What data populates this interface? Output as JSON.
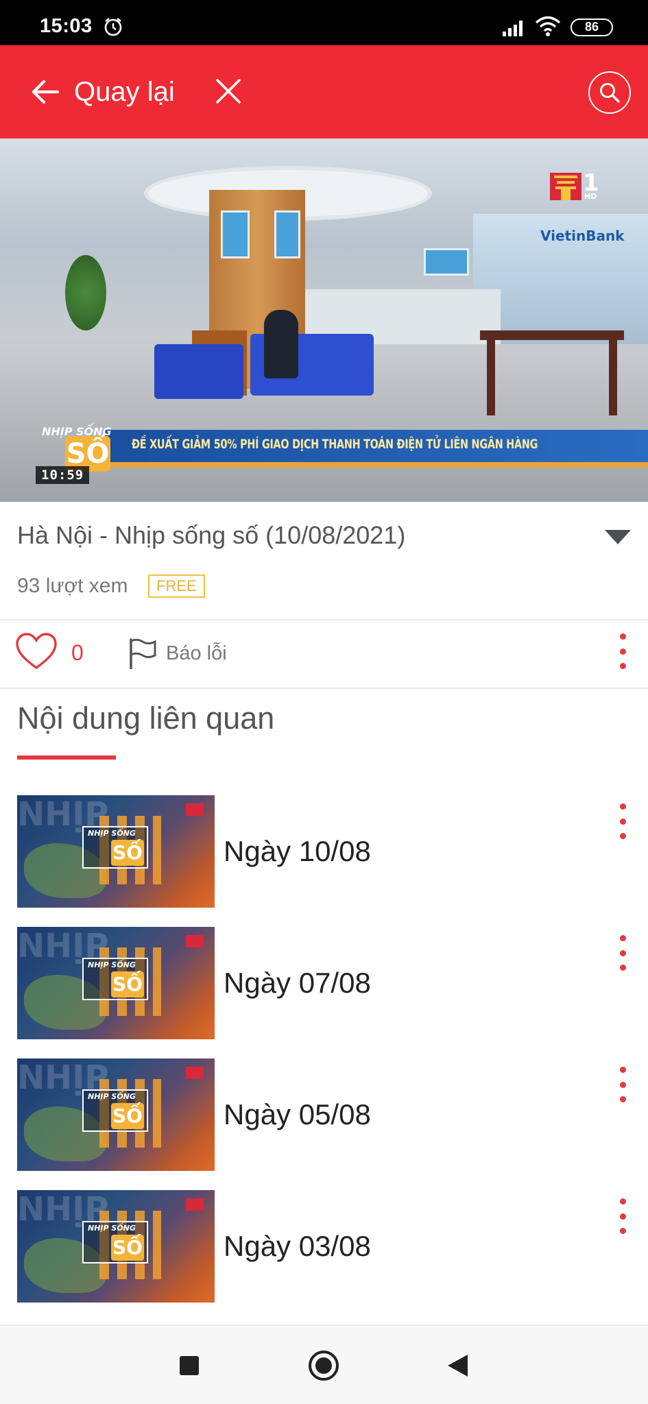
{
  "status_bar": {
    "time": "15:03",
    "battery": "86"
  },
  "app_bar": {
    "back_label": "Quay lại"
  },
  "video": {
    "ticker": "ĐỀ XUẤT GIẢM 50% PHÍ GIAO DỊCH THANH TOÁN ĐIỆN TỬ LIÊN NGÂN HÀNG",
    "clock": "10:59",
    "show_badge_top": "NHỊP SỐNG",
    "show_badge_main": "SỐ",
    "bank_sign": "VietinBank",
    "channel_hd": "HD"
  },
  "content": {
    "title": "Hà Nội - Nhịp sống số (10/08/2021)",
    "views": "93 lượt xem",
    "badge": "FREE"
  },
  "actions": {
    "like_count": "0",
    "report_label": "Báo lỗi"
  },
  "related": {
    "heading": "Nội dung liên quan",
    "items": [
      {
        "label": "Ngày 10/08"
      },
      {
        "label": "Ngày 07/08"
      },
      {
        "label": "Ngày 05/08"
      },
      {
        "label": "Ngày 03/08"
      }
    ],
    "thumb_small_text": "NHỊP SỐNG",
    "thumb_main_text": "SỐ",
    "thumb_bg_text": "NHỊP"
  },
  "colors": {
    "accent": "#ee2a34",
    "badge": "#f0c040",
    "text_muted": "#777777"
  },
  "icons": [
    "alarm-icon",
    "signal-icon",
    "wifi-icon",
    "battery-icon",
    "arrow-left-icon",
    "close-icon",
    "search-icon",
    "chevron-down-icon",
    "heart-icon",
    "flag-icon",
    "more-vertical-icon",
    "square-icon",
    "circle-icon",
    "triangle-back-icon"
  ]
}
